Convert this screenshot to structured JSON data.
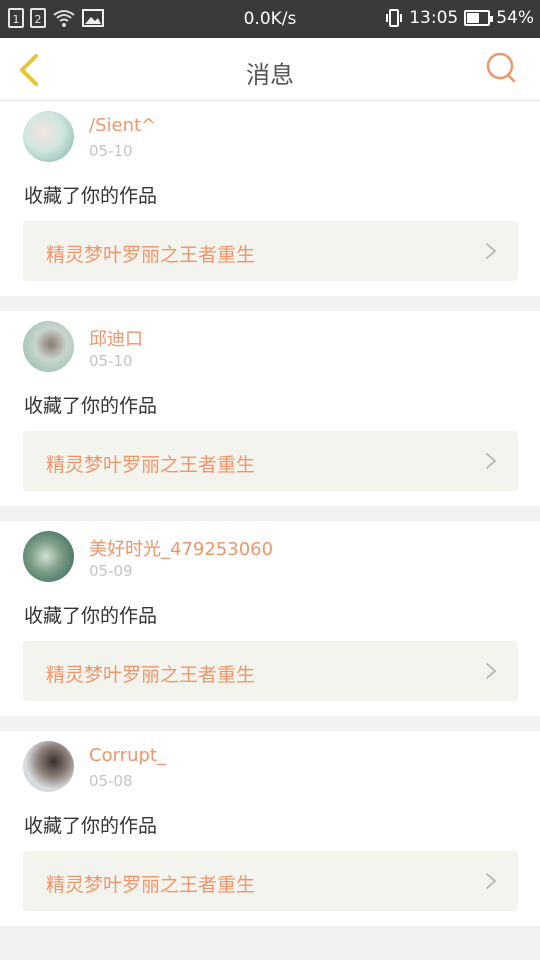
{
  "status_bar": {
    "sim1": "1",
    "sim2": "2",
    "speed": "0.0K/s",
    "time": "13:05",
    "battery": "54%",
    "battery_level": 0.54
  },
  "header": {
    "title": "消息",
    "back_icon": "chevron-left-icon",
    "search_icon": "search-icon",
    "accent_color": "#f0956a",
    "back_color": "#e6c53a"
  },
  "messages": [
    {
      "username": "/Sient^",
      "date": "05-10",
      "action": "收藏了你的作品",
      "work_title": "精灵梦叶罗丽之王者重生"
    },
    {
      "username": "邱迪口",
      "date": "05-10",
      "action": "收藏了你的作品",
      "work_title": "精灵梦叶罗丽之王者重生"
    },
    {
      "username": "美好时光_479253060",
      "date": "05-09",
      "action": "收藏了你的作品",
      "work_title": "精灵梦叶罗丽之王者重生"
    },
    {
      "username": "Corrupt_",
      "date": "05-08",
      "action": "收藏了你的作品",
      "work_title": "精灵梦叶罗丽之王者重生"
    }
  ]
}
